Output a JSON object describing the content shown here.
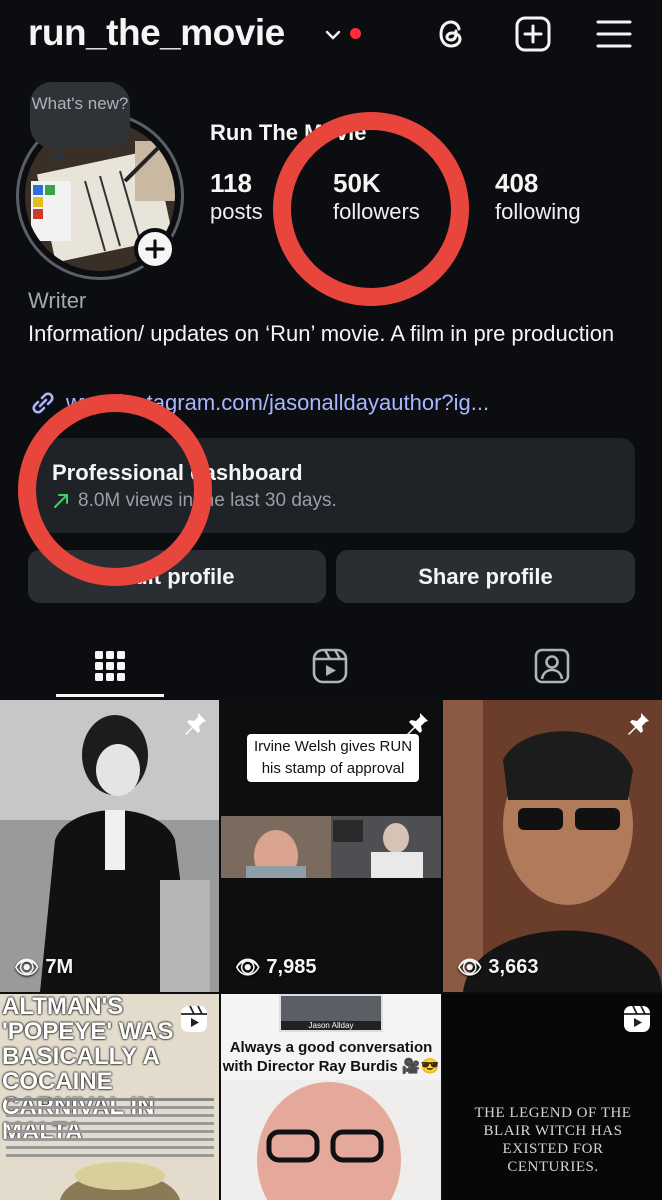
{
  "header": {
    "username": "run_the_movie",
    "icons": [
      "threads-icon",
      "new-post-icon",
      "menu-icon"
    ],
    "notification_color": "#ff2d3b"
  },
  "profile": {
    "note": "What's new?",
    "display_name": "Run The Movie",
    "stats": [
      {
        "num": "118",
        "label": "posts"
      },
      {
        "num": "50K",
        "label": "followers"
      },
      {
        "num": "408",
        "label": "following"
      }
    ],
    "category": "Writer",
    "bio": "Information/ updates on ‘Run’ movie. A film in pre production",
    "link": "www.instagram.com/jasonalldayauthor?ig..."
  },
  "dashboard": {
    "title": "Professional dashboard",
    "subtitle": "8.0M views in the last 30 days."
  },
  "buttons": {
    "edit": "Edit profile",
    "share": "Share profile"
  },
  "tabs": [
    "grid-icon",
    "reels-icon",
    "tagged-icon"
  ],
  "grid": [
    {
      "views": "7M",
      "pinned": true
    },
    {
      "views": "7,985",
      "pinned": true,
      "caption": "Irvine Welsh gives RUN his stamp of approval"
    },
    {
      "views": "3,663",
      "pinned": true
    },
    {
      "headline": "ALTMAN'S 'POPEYE' WAS BASICALLY A COCAINE CARNIVAL IN MALTA",
      "reel": true
    },
    {
      "caption": "Always a good conversation with Director Ray Burdis 🎥😎",
      "chip": "Jason Allday"
    },
    {
      "text": "THE LEGEND OF THE BLAIR WITCH HAS EXISTED FOR CENTURIES.",
      "reel": true
    }
  ],
  "colors": {
    "background": "#0b0d10",
    "link": "#a9b6ff",
    "annotation": "#e8453c",
    "trend": "#3ecf6b"
  }
}
